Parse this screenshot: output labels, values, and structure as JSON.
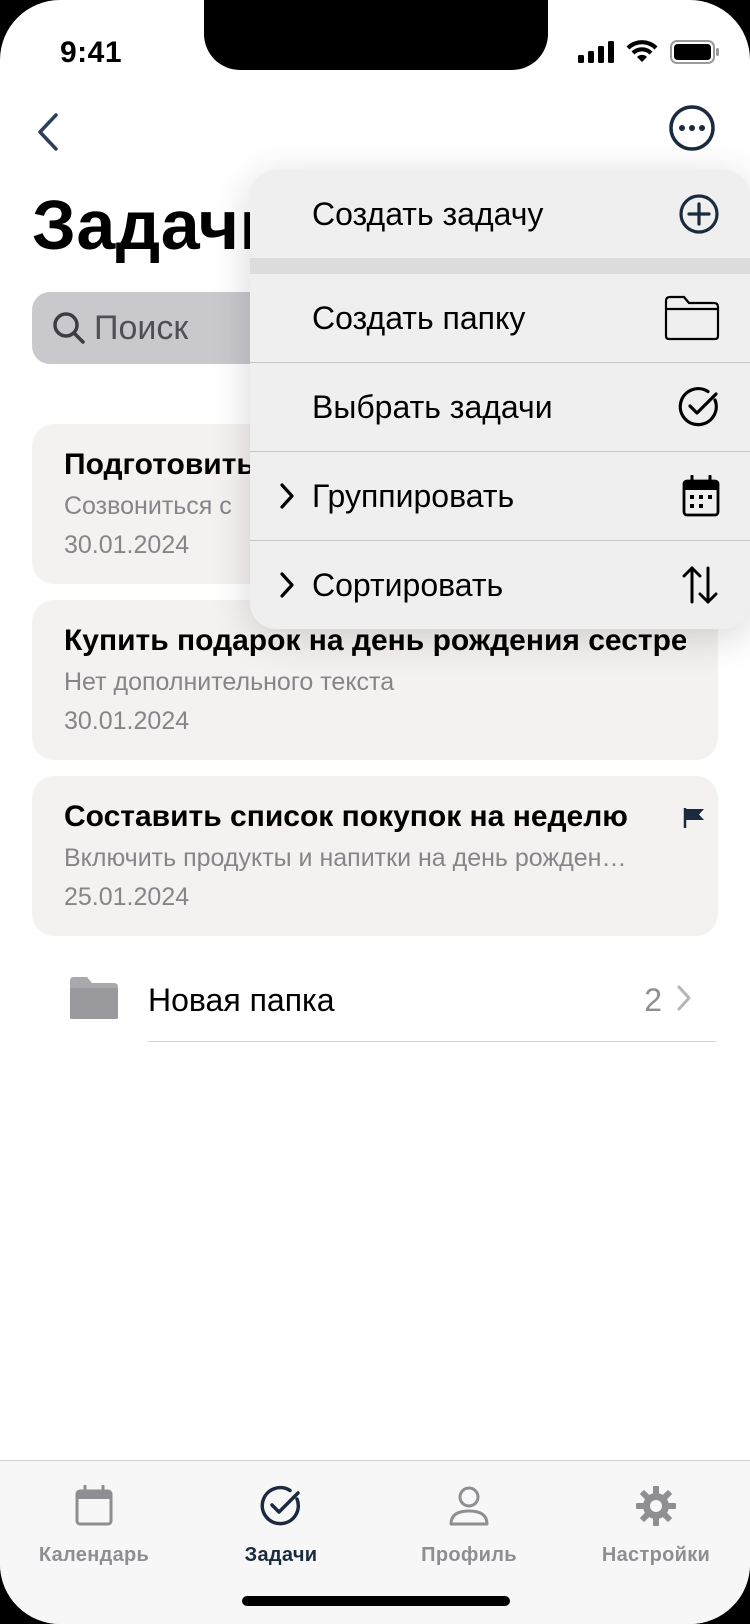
{
  "status_bar": {
    "time": "9:41"
  },
  "header": {
    "title": "Задачи",
    "back_icon": "chevron-left-icon",
    "more_icon": "ellipsis-circle-icon"
  },
  "search": {
    "placeholder": "Поиск",
    "value": ""
  },
  "tasks": [
    {
      "title": "Подготовить",
      "subtitle": "Созвониться с",
      "date": "30.01.2024",
      "flagged": false
    },
    {
      "title": "Купить подарок на день рождения сестре",
      "subtitle": "Нет дополнительного текста",
      "date": "30.01.2024",
      "flagged": false
    },
    {
      "title": "Составить список покупок на неделю",
      "subtitle": "Включить продукты и напитки на день рожден…",
      "date": "25.01.2024",
      "flagged": true
    }
  ],
  "folder": {
    "name": "Новая папка",
    "count": "2"
  },
  "menu": {
    "items": [
      {
        "label": "Создать задачу",
        "icon": "plus-circle-icon",
        "submenu": false
      },
      {
        "label": "Создать папку",
        "icon": "folder-icon",
        "submenu": false
      },
      {
        "label": "Выбрать задачи",
        "icon": "check-circle-icon",
        "submenu": false
      },
      {
        "label": "Группировать",
        "icon": "calendar-icon",
        "submenu": true
      },
      {
        "label": "Сортировать",
        "icon": "sort-arrows-icon",
        "submenu": true
      }
    ]
  },
  "tabbar": {
    "tabs": [
      {
        "label": "Календарь",
        "icon": "calendar-icon",
        "active": false
      },
      {
        "label": "Задачи",
        "icon": "check-circle-icon",
        "active": true
      },
      {
        "label": "Профиль",
        "icon": "person-icon",
        "active": false
      },
      {
        "label": "Настройки",
        "icon": "gear-icon",
        "active": false
      }
    ]
  },
  "colors": {
    "accent": "#1b2a3e",
    "card_bg": "#f5f1f0",
    "secondary_text": "#86858a",
    "search_bg": "#c9c8cd",
    "menu_bg": "#f0efef"
  }
}
